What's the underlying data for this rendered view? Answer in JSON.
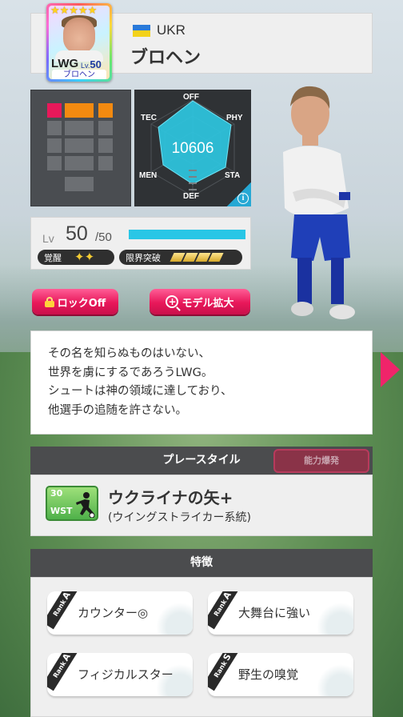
{
  "player": {
    "nation": "UKR",
    "name": "ブロヘン",
    "position": "LWG",
    "lv_prefix": "Lv.",
    "card_level": "50",
    "card_name": "ブロヘン",
    "stars": "★★★★★"
  },
  "radar": {
    "labels": {
      "off": "OFF",
      "phy": "PHY",
      "sta": "STA",
      "def": "DEF",
      "men": "MEN",
      "tec": "TEC"
    },
    "total": "10606",
    "info_icon": "info-icon"
  },
  "level": {
    "label": "Lv",
    "current": "50",
    "max": "/50",
    "progress": 1.0,
    "awaken_label": "覚醒",
    "awaken_marks": "✦✦",
    "limit_label": "限界突破",
    "limit_steps": 4
  },
  "buttons": {
    "lock_label": "ロックOff",
    "model_label": "モデル拡大",
    "ability_label": "能力爆発"
  },
  "description": [
    "その名を知らぬものはいない、",
    "世界を虜にするであろうLWG。",
    "シュートは神の領域に達しており、",
    "他選手の追随を許さない。"
  ],
  "play_style": {
    "header": "プレースタイル",
    "badge_number": "30",
    "badge_code": "WST",
    "name": "ウクライナの矢+",
    "subtitle": "(ウイングストライカー系統)"
  },
  "traits": {
    "header": "特徴",
    "rank_word": "Rank",
    "items": [
      {
        "rank": "A",
        "label": "カウンター◎"
      },
      {
        "rank": "A",
        "label": "大舞台に強い"
      },
      {
        "rank": "A",
        "label": "フィジカルスター"
      },
      {
        "rank": "S",
        "label": "野生の嗅覚"
      }
    ]
  },
  "colors": {
    "accent_pink": "#e8185a",
    "radar_fill": "#2ec5e0",
    "formation_active_red": "#e8185a",
    "formation_active_orange": "#f38a10",
    "level_bar": "#29c6e6"
  }
}
